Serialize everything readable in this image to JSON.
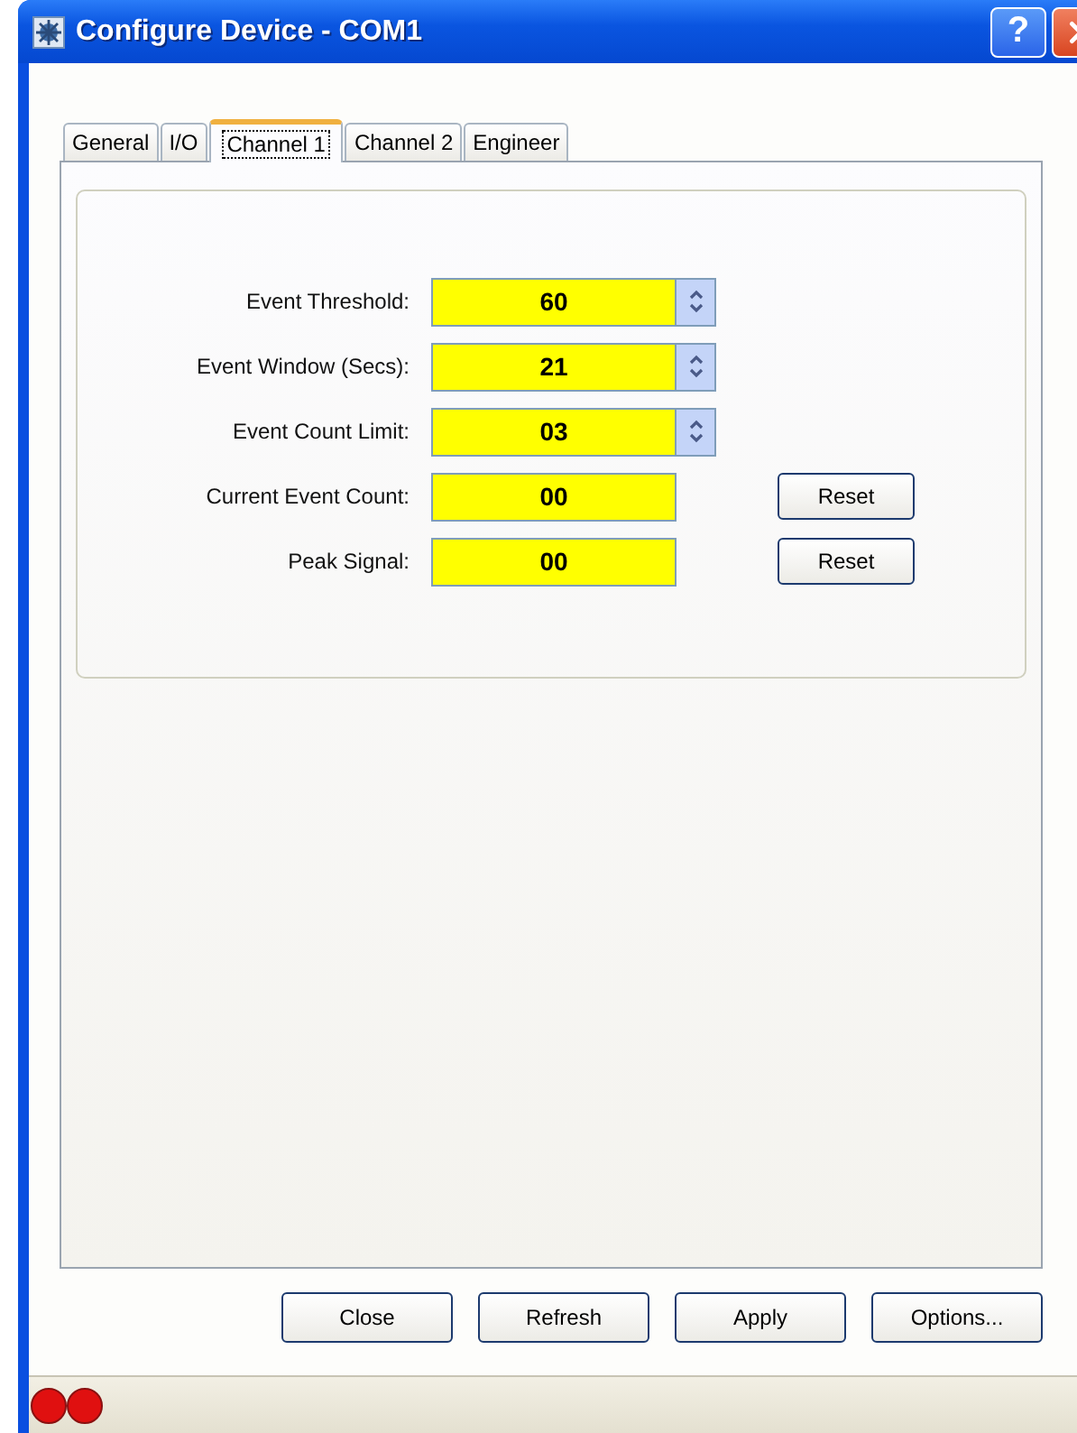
{
  "window": {
    "title": "Configure Device -  COM1",
    "help_button": "?"
  },
  "tabs": [
    {
      "label": "General",
      "selected": false
    },
    {
      "label": "I/O",
      "selected": false
    },
    {
      "label": "Channel 1",
      "selected": true
    },
    {
      "label": "Channel 2",
      "selected": false
    },
    {
      "label": "Engineer",
      "selected": false
    }
  ],
  "fields": [
    {
      "label": "Event Threshold:",
      "value": "60",
      "kind": "spin"
    },
    {
      "label": "Event Window (Secs):",
      "value": "21",
      "kind": "spin"
    },
    {
      "label": "Event Count Limit:",
      "value": "03",
      "kind": "spin"
    },
    {
      "label": "Current Event Count:",
      "value": "00",
      "kind": "reset",
      "button": "Reset"
    },
    {
      "label": "Peak Signal:",
      "value": "00",
      "kind": "reset",
      "button": "Reset"
    }
  ],
  "buttons": [
    "Close",
    "Refresh",
    "Apply",
    "Options..."
  ],
  "status_bar": {
    "lights": [
      {
        "color": "#e01010"
      },
      {
        "color": "#e01010"
      }
    ]
  }
}
